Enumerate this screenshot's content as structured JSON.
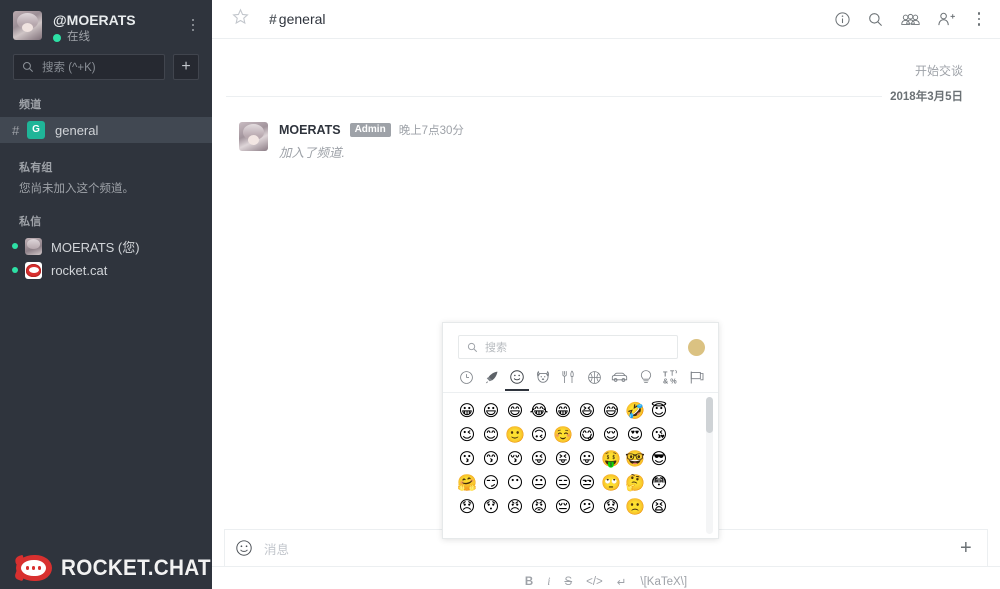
{
  "colors": {
    "sidebar_bg": "#2f343d",
    "sidebar_active": "#414852",
    "accent_green": "#2de0a5",
    "badge_green": "#1fb598",
    "brand_red": "#d8302f",
    "tone_swatch": "#dbc282",
    "text_light": "#e8ebed",
    "text_muted": "#9ea2a8",
    "main_text": "#2f343d"
  },
  "sidebar": {
    "user": {
      "name": "@MOERATS",
      "status_label": "在线",
      "avatar_name": "user-avatar",
      "kebab_name": "sidebar-options-kebab"
    },
    "search": {
      "placeholder": "搜索 (^+K)",
      "icon": "search-icon"
    },
    "create_button": {
      "label": "+",
      "icon": "plus-icon"
    },
    "sections": [
      {
        "title": "频道",
        "type": "channels",
        "items": [
          {
            "hash": "#",
            "badge": "G",
            "label": "general",
            "active": true
          }
        ],
        "note": ""
      },
      {
        "title": "私有组",
        "type": "note",
        "items": [],
        "note": "您尚未加入这个频道。"
      },
      {
        "title": "私信",
        "type": "dms",
        "items": [
          {
            "label": "MOERATS (您)",
            "avatar": "girl",
            "online": true
          },
          {
            "label": "rocket.cat",
            "avatar": "cat",
            "online": true
          }
        ],
        "note": ""
      }
    ],
    "logo": {
      "text": "ROCKET.CHAT",
      "mark_name": "rocket-chat-logo-icon"
    }
  },
  "topbar": {
    "star_icon": "star-icon",
    "hash": "#",
    "channel_name": "general",
    "icons": [
      {
        "name": "info-circle-icon",
        "label": "信息"
      },
      {
        "name": "search-icon",
        "label": "搜索"
      },
      {
        "name": "members-group-icon",
        "label": "成员"
      },
      {
        "name": "add-user-icon",
        "label": "添加用户"
      },
      {
        "name": "kebab-menu-icon",
        "label": "更多"
      }
    ]
  },
  "main": {
    "start_label": "开始交谈",
    "date_divider": "2018年3月5日",
    "messages": [
      {
        "user": "MOERATS",
        "role": "Admin",
        "time": "晚上7点30分",
        "text": "加入了频道."
      }
    ]
  },
  "composer": {
    "emoji_icon": "smiley-icon",
    "placeholder": "消息",
    "plus_icon": "plus-icon",
    "tools": [
      {
        "name": "bold-button",
        "label": "B",
        "style": "b"
      },
      {
        "name": "italic-button",
        "label": "i",
        "style": "i"
      },
      {
        "name": "strike-button",
        "label": "S",
        "style": "s"
      },
      {
        "name": "code-button",
        "label": "</>",
        "style": "n"
      },
      {
        "name": "linebreak-button",
        "label": "↵",
        "style": "n"
      },
      {
        "name": "katex-button",
        "label": "\\[KaTeX\\]",
        "style": "n"
      }
    ]
  },
  "emoji_picker": {
    "search_placeholder": "搜索",
    "search_icon": "search-icon",
    "tone_swatch_name": "skin-tone-swatch",
    "tabs": [
      {
        "name": "tab-recent",
        "glyph": "clock",
        "active": false
      },
      {
        "name": "tab-custom",
        "glyph": "rocket",
        "active": false
      },
      {
        "name": "tab-people",
        "glyph": "smiley",
        "active": true
      },
      {
        "name": "tab-nature",
        "glyph": "dog",
        "active": false
      },
      {
        "name": "tab-food",
        "glyph": "fork-knife",
        "active": false
      },
      {
        "name": "tab-activity",
        "glyph": "basketball",
        "active": false
      },
      {
        "name": "tab-travel",
        "glyph": "car",
        "active": false
      },
      {
        "name": "tab-objects",
        "glyph": "lightbulb",
        "active": false
      },
      {
        "name": "tab-symbols",
        "glyph": "symbols",
        "active": false
      },
      {
        "name": "tab-flags",
        "glyph": "flag",
        "active": false
      }
    ],
    "emoji_rows": [
      [
        "😀",
        "😃",
        "😄",
        "😂",
        "😁",
        "😆",
        "😅",
        "🤣",
        "😇"
      ],
      [
        "😉",
        "😊",
        "🙂",
        "🙃",
        "☺️",
        "😋",
        "😌",
        "😍",
        "😘"
      ],
      [
        "😗",
        "😙",
        "😚",
        "😜",
        "😝",
        "😛",
        "🤑",
        "🤓",
        "😎"
      ],
      [
        "🤗",
        "😏",
        "😶",
        "😐",
        "😑",
        "😒",
        "🙄",
        "🤔",
        "😳"
      ],
      [
        "😞",
        "😯",
        "😠",
        "😡",
        "😔",
        "😕",
        "😟",
        "🙁",
        "😫"
      ]
    ],
    "scrollbar_name": "emoji-grid-scrollbar"
  }
}
